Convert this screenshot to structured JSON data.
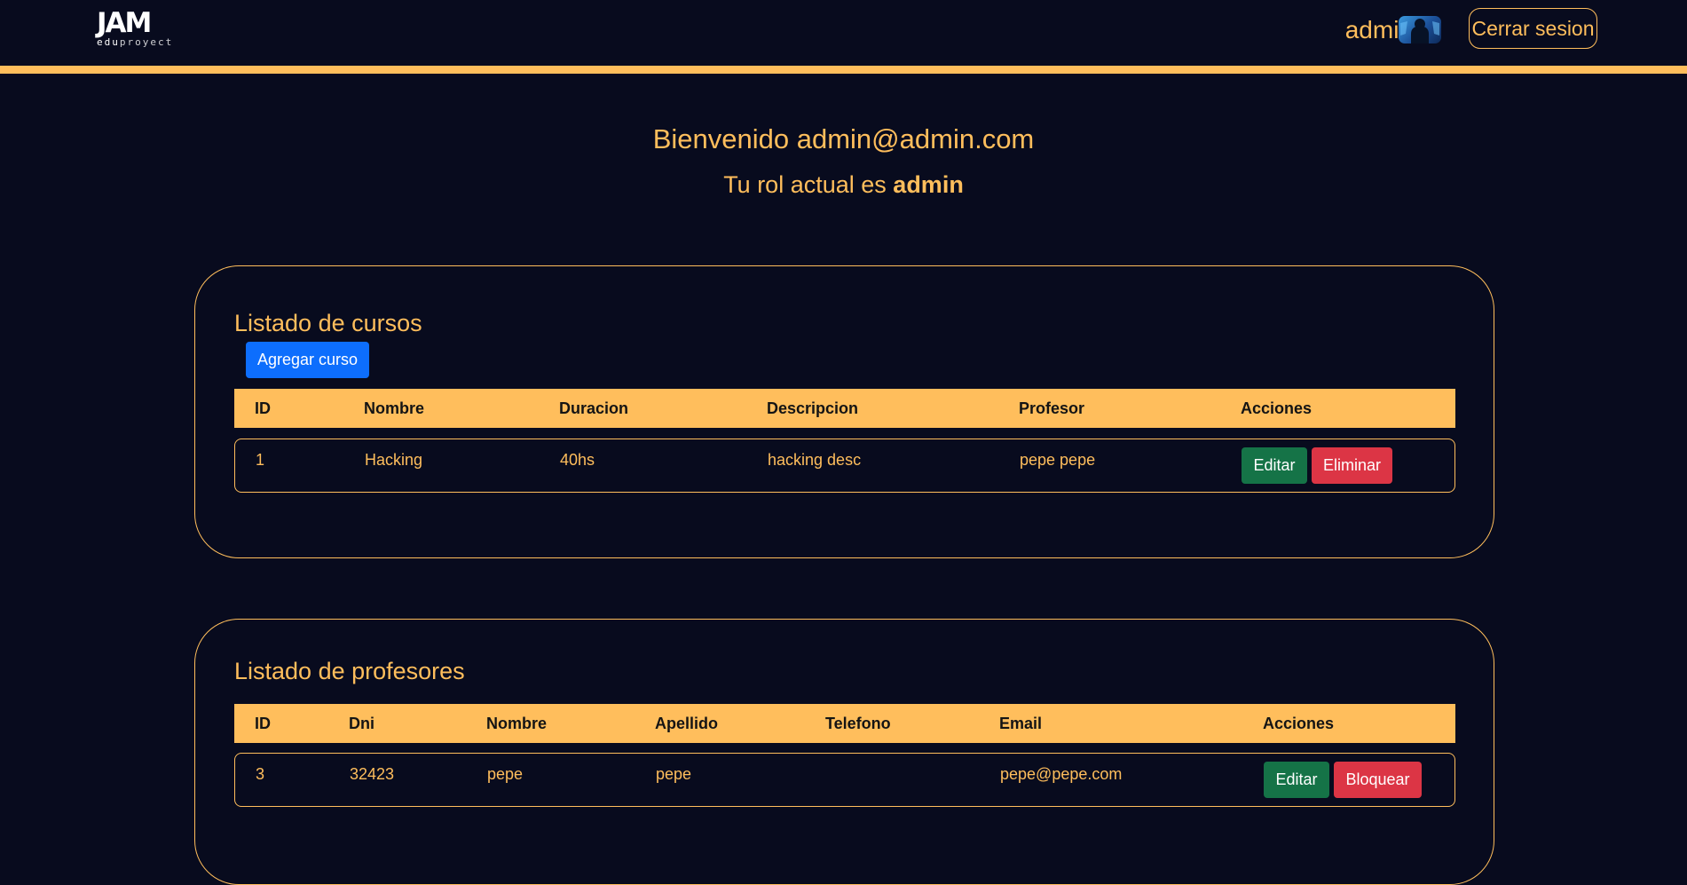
{
  "header": {
    "logo_main": "JAM",
    "logo_sub_a": "edu",
    "logo_sub_b": "proyect",
    "username": "admin",
    "logout_label": "Cerrar sesion"
  },
  "welcome": {
    "greeting": "Bienvenido admin@admin.com",
    "role_prefix": "Tu rol actual es",
    "role": "admin"
  },
  "courses": {
    "title": "Listado de cursos",
    "add_label": "Agregar curso",
    "columns": [
      "ID",
      "Nombre",
      "Duracion",
      "Descripcion",
      "Profesor",
      "Acciones"
    ],
    "rows": [
      {
        "id": "1",
        "nombre": "Hacking",
        "duracion": "40hs",
        "descripcion": "hacking desc",
        "profesor": "pepe pepe",
        "edit_label": "Editar",
        "delete_label": "Eliminar"
      }
    ]
  },
  "teachers": {
    "title": "Listado de profesores",
    "columns": [
      "ID",
      "Dni",
      "Nombre",
      "Apellido",
      "Telefono",
      "Email",
      "Acciones"
    ],
    "rows": [
      {
        "id": "3",
        "dni": "32423",
        "nombre": "pepe",
        "apellido": "pepe",
        "telefono": "",
        "email": "pepe@pepe.com",
        "edit_label": "Editar",
        "block_label": "Bloquear"
      }
    ]
  },
  "colors": {
    "background": "#080b1e",
    "accent": "#ffbe5c",
    "primary": "#0d6efd",
    "success": "#157347",
    "danger": "#dc3545"
  },
  "icons": {
    "avatar": "user-avatar-icon"
  }
}
